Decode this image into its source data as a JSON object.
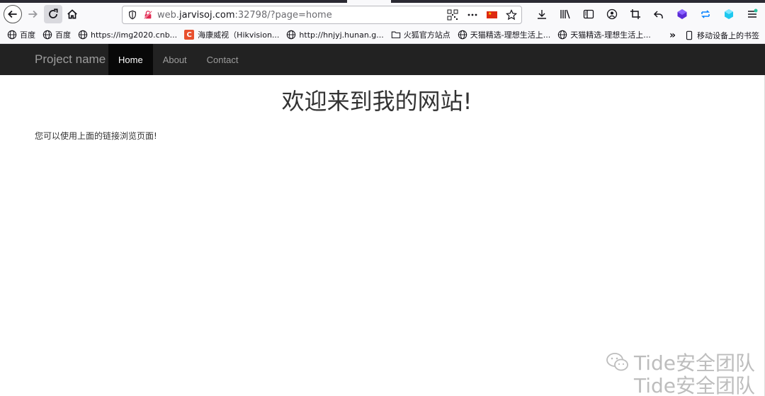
{
  "browser": {
    "url_prefix": "web.",
    "url_host": "jarvisoj.com",
    "url_rest": ":32798/?page=home"
  },
  "bookmarks": [
    {
      "label": "百度",
      "icon": "globe-icon"
    },
    {
      "label": "百度",
      "icon": "globe-icon"
    },
    {
      "label": "https://img2020.cnb...",
      "icon": "globe-icon"
    },
    {
      "label": "海康威视（Hikvision...",
      "icon": "c-logo-icon"
    },
    {
      "label": "http://hnjyj.hunan.g...",
      "icon": "globe-icon"
    },
    {
      "label": "火狐官方站点",
      "icon": "folder-icon"
    },
    {
      "label": "天猫精选-理想生活上...",
      "icon": "globe-icon"
    },
    {
      "label": "天猫精选-理想生活上...",
      "icon": "globe-icon"
    }
  ],
  "mobile_bookmarks_label": "移动设备上的书签",
  "site": {
    "brand": "Project name",
    "nav": [
      "Home",
      "About",
      "Contact"
    ],
    "heading": "欢迎来到我的网站!",
    "paragraph": "您可以使用上面的链接浏览页面!"
  },
  "watermark": {
    "line1": "Tide安全团队",
    "line2": "Tide安全团队"
  },
  "colors": {
    "navbar_bg": "#222222",
    "active_tab_bg": "#080808",
    "nav_text": "#9d9d9d"
  }
}
